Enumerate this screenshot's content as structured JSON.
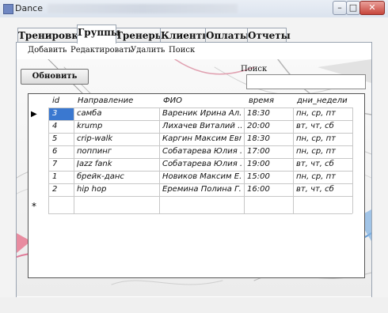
{
  "window": {
    "title": "Dance"
  },
  "tabs": [
    {
      "label": "Тренировки"
    },
    {
      "label": "Группы"
    },
    {
      "label": "Тренеры"
    },
    {
      "label": "Клиенты"
    },
    {
      "label": "Оплаты"
    },
    {
      "label": "Отчеты"
    }
  ],
  "active_tab": "Группы",
  "menu": [
    {
      "label": "Добавить"
    },
    {
      "label": "Редактировать"
    },
    {
      "label": "Удалить"
    },
    {
      "label": "Поиск"
    }
  ],
  "search": {
    "label": "Поиск",
    "value": ""
  },
  "refresh_button": {
    "label": "Обновить"
  },
  "grid": {
    "columns": [
      "id",
      "Направление",
      "ФИО",
      "время",
      "дни_недели"
    ],
    "rows": [
      [
        "3",
        "самба",
        "Вареник Ирина Ал...",
        "18:30",
        "пн, ср, пт"
      ],
      [
        "4",
        "krump",
        "Лихачев Виталий ...",
        "20:00",
        "вт, чт, сб"
      ],
      [
        "5",
        "crip-walk",
        "Каргин Максим Евг...",
        "18:30",
        "пн, ср, пт"
      ],
      [
        "6",
        "поппинг",
        "Собатарева Юлия ...",
        "17:00",
        "пн, ср, пт"
      ],
      [
        "7",
        "Jazz fank",
        "Собатарева Юлия ...",
        "19:00",
        "вт, чт, сб"
      ],
      [
        "1",
        "брейк-данс",
        "Новиков Максим Е...",
        "15:00",
        "пн, ср, пт"
      ],
      [
        "2",
        "hip hop",
        "Еремина Полина Г...",
        "16:00",
        "вт, чт, сб"
      ]
    ],
    "current_row_marker": "▶",
    "new_row_marker": "*"
  }
}
